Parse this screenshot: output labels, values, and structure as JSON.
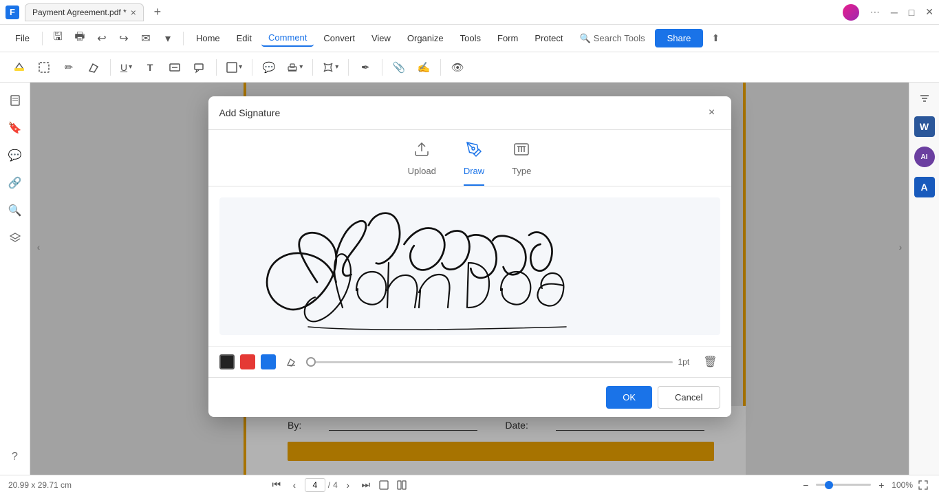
{
  "titlebar": {
    "app_icon": "F",
    "tab_title": "Payment Agreement.pdf *",
    "tab_close": "×",
    "tab_add": "+",
    "minimize": "–",
    "maximize": "□",
    "close": "×"
  },
  "menubar": {
    "file": "File",
    "home": "Home",
    "edit": "Edit",
    "comment": "Comment",
    "convert": "Convert",
    "view": "View",
    "organize": "Organize",
    "tools": "Tools",
    "form": "Form",
    "protect": "Protect",
    "search_tools": "Search Tools",
    "share": "Share"
  },
  "toolbar": {
    "tools": [
      "✏",
      "⬜",
      "✒",
      "⊘",
      "U",
      "T",
      "⬚",
      "⬚",
      "⬜",
      "💬",
      "📅",
      "✋",
      "✒",
      "🔗",
      "✍",
      "👁"
    ]
  },
  "dialog": {
    "title": "Add Signature",
    "close": "×",
    "tabs": [
      {
        "id": "upload",
        "label": "Upload",
        "icon": "⬆"
      },
      {
        "id": "draw",
        "label": "Draw",
        "icon": "✏",
        "active": true
      },
      {
        "id": "type",
        "label": "Type",
        "icon": "⌨"
      }
    ],
    "colors": [
      {
        "id": "black",
        "selected": true
      },
      {
        "id": "red",
        "selected": false
      },
      {
        "id": "blue",
        "selected": false
      }
    ],
    "thickness_label": "1pt",
    "ok_label": "OK",
    "cancel_label": "Cancel"
  },
  "document": {
    "by_label": "By:",
    "date_label": "Date:"
  },
  "statusbar": {
    "coordinates": "20.99 x 29.71 cm",
    "page_current": "4",
    "page_total": "4",
    "zoom_level": "100%"
  }
}
